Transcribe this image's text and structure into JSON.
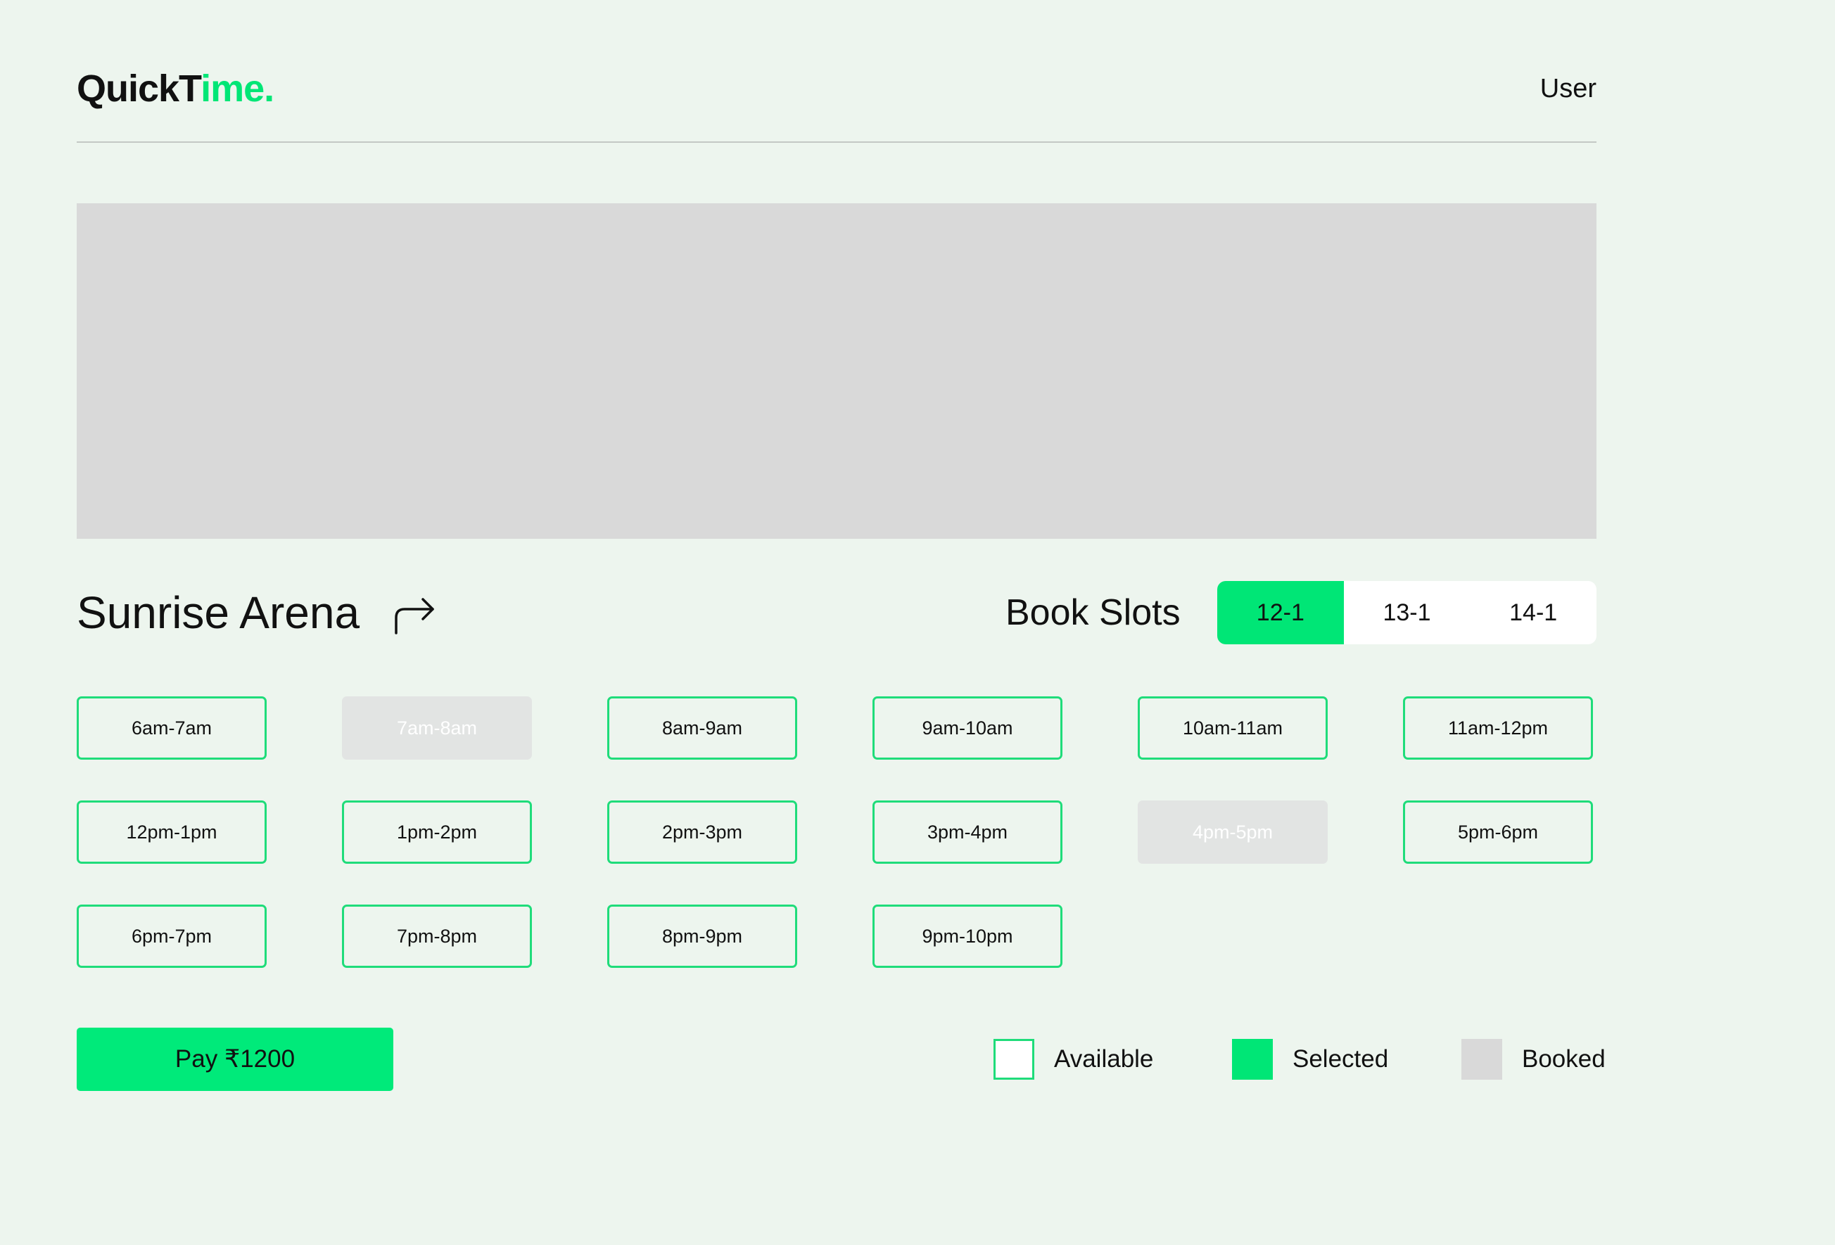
{
  "header": {
    "logo_main": "QuickT",
    "logo_accent": "ime.",
    "user_label": "User"
  },
  "venue": {
    "name": "Sunrise Arena",
    "share_icon": "share-arrow-icon"
  },
  "booking": {
    "title": "Book Slots",
    "dates": [
      "12-1",
      "13-1",
      "14-1"
    ],
    "selected_date": "12-1"
  },
  "slots": [
    {
      "label": "6am-7am",
      "status": "available"
    },
    {
      "label": "7am-8am",
      "status": "booked"
    },
    {
      "label": "8am-9am",
      "status": "available"
    },
    {
      "label": "9am-10am",
      "status": "available"
    },
    {
      "label": "10am-11am",
      "status": "available"
    },
    {
      "label": "11am-12pm",
      "status": "available"
    },
    {
      "label": "12pm-1pm",
      "status": "available"
    },
    {
      "label": "1pm-2pm",
      "status": "available"
    },
    {
      "label": "2pm-3pm",
      "status": "available"
    },
    {
      "label": "3pm-4pm",
      "status": "available"
    },
    {
      "label": "4pm-5pm",
      "status": "booked"
    },
    {
      "label": "5pm-6pm",
      "status": "available"
    },
    {
      "label": "6pm-7pm",
      "status": "available"
    },
    {
      "label": "7pm-8pm",
      "status": "available"
    },
    {
      "label": "8pm-9pm",
      "status": "available"
    },
    {
      "label": "9pm-10pm",
      "status": "available"
    }
  ],
  "pay": {
    "label": "Pay ₹1200"
  },
  "legend": {
    "available": "Available",
    "selected": "Selected",
    "booked": "Booked"
  },
  "colors": {
    "accent": "#00e676",
    "background": "#edf5ee",
    "booked": "#e2e4e3",
    "placeholder": "#d9d9d9"
  }
}
